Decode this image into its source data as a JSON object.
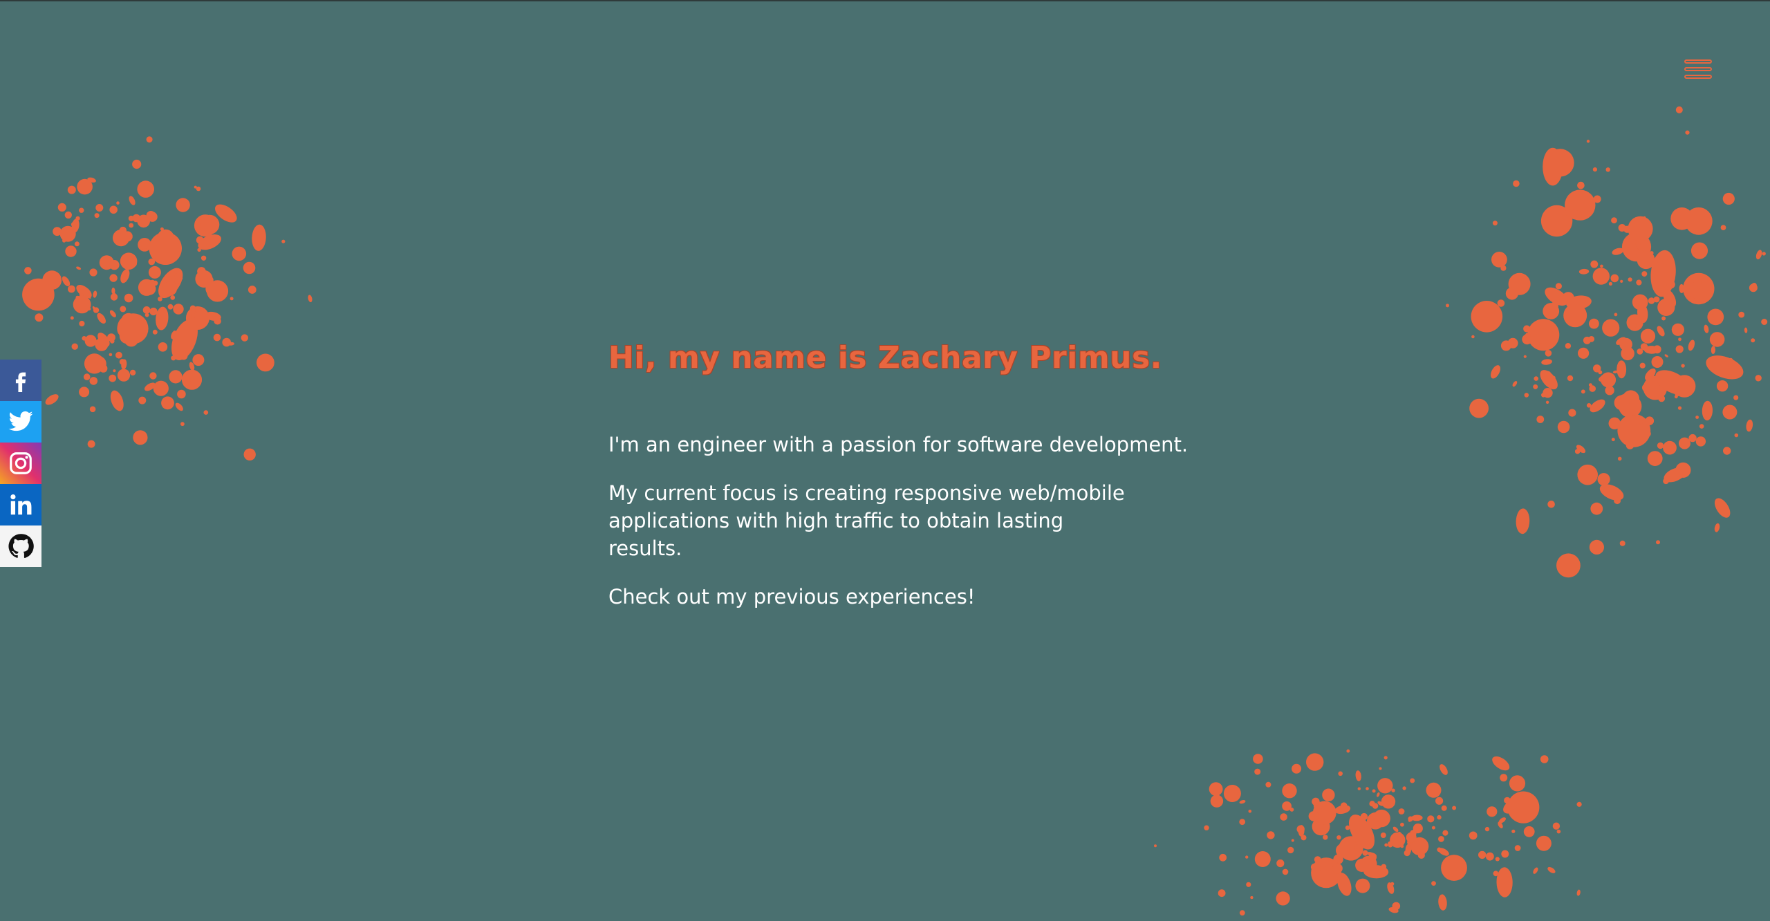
{
  "intro": {
    "headline": "Hi, my name is Zachary Primus.",
    "paragraphs": [
      "I'm an engineer with a passion for software development.",
      "My current focus is creating responsive web/mobile applications with high traffic to obtain lasting results.",
      "Check out my previous experiences!"
    ]
  },
  "social": {
    "items": [
      {
        "name": "facebook",
        "icon": "facebook-icon"
      },
      {
        "name": "twitter",
        "icon": "twitter-icon"
      },
      {
        "name": "instagram",
        "icon": "instagram-icon"
      },
      {
        "name": "linkedin",
        "icon": "linkedin-icon"
      },
      {
        "name": "github",
        "icon": "github-icon"
      }
    ]
  },
  "menu": {
    "icon": "hamburger-menu-icon"
  },
  "colors": {
    "background": "#4a7070",
    "accent": "#e8663f",
    "text": "#ffffff",
    "facebook": "#3b5998",
    "twitter": "#1da1f2",
    "linkedin": "#0a66c2",
    "github_bg": "#f4f4f4"
  }
}
